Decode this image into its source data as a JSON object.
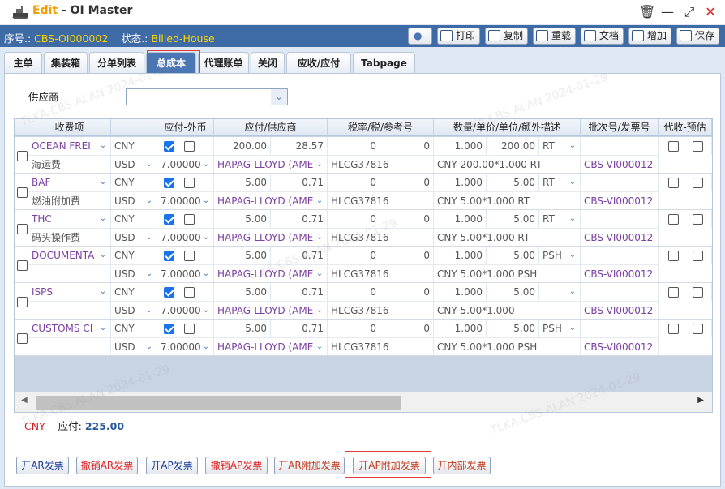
{
  "window": {
    "mode": "Edit",
    "title": "OI Master"
  },
  "info": {
    "seq_label": "序号.:",
    "seq_value": "CBS-OI000002",
    "status_label": "状态.:",
    "status_value": "Billed-House"
  },
  "toolbar": {
    "print": "打印",
    "copy": "复制",
    "reload": "重载",
    "docs": "文档",
    "add": "增加",
    "save": "保存"
  },
  "tabs": [
    "主单",
    "集装箱",
    "分单列表",
    "总成本",
    "代理账单",
    "关闭",
    "应收/应付",
    "Tabpage"
  ],
  "supplier": {
    "label": "供应商",
    "value": ""
  },
  "grid": {
    "headers": [
      "收费项",
      "应付-外币",
      "应付/供应商",
      "税率/税/参考号",
      "数量/单价/单位/额外描述",
      "批次号/发票号",
      "代收-预估"
    ],
    "rows": [
      {
        "code": "OCEAN FREI",
        "name": "海运费",
        "currency": "CNY",
        "fx_ccy": "USD",
        "rate": "7.00000",
        "fc_checked": true,
        "amt": "200.00",
        "amt2": "28.57",
        "supplier": "HAPAG-LLOYD (AME",
        "tax": "0",
        "tax2": "0",
        "ref": "HLCG37816",
        "qty": "1.000",
        "price": "200.00",
        "unit": "RT",
        "desc": "CNY 200.00*1.000 RT",
        "batch": "",
        "invoice": "CBS-VI000012"
      },
      {
        "code": "BAF",
        "name": "燃油附加费",
        "currency": "CNY",
        "fx_ccy": "USD",
        "rate": "7.00000",
        "fc_checked": true,
        "amt": "5.00",
        "amt2": "0.71",
        "supplier": "HAPAG-LLOYD (AME",
        "tax": "0",
        "tax2": "0",
        "ref": "HLCG37816",
        "qty": "1.000",
        "price": "5.00",
        "unit": "RT",
        "desc": "CNY 5.00*1.000 RT",
        "batch": "",
        "invoice": "CBS-VI000012"
      },
      {
        "code": "THC",
        "name": "码头操作费",
        "currency": "CNY",
        "fx_ccy": "USD",
        "rate": "7.00000",
        "fc_checked": true,
        "amt": "5.00",
        "amt2": "0.71",
        "supplier": "HAPAG-LLOYD (AME",
        "tax": "0",
        "tax2": "0",
        "ref": "HLCG37816",
        "qty": "1.000",
        "price": "5.00",
        "unit": "RT",
        "desc": "CNY 5.00*1.000 RT",
        "batch": "",
        "invoice": "CBS-VI000012"
      },
      {
        "code": "DOCUMENTA",
        "name": "",
        "currency": "CNY",
        "fx_ccy": "USD",
        "rate": "7.00000",
        "fc_checked": true,
        "amt": "5.00",
        "amt2": "0.71",
        "supplier": "HAPAG-LLOYD (AME",
        "tax": "0",
        "tax2": "0",
        "ref": "HLCG37816",
        "qty": "1.000",
        "price": "5.00",
        "unit": "PSH",
        "desc": "CNY 5.00*1.000 PSH",
        "batch": "",
        "invoice": "CBS-VI000012"
      },
      {
        "code": "ISPS",
        "name": "",
        "currency": "CNY",
        "fx_ccy": "USD",
        "rate": "7.00000",
        "fc_checked": true,
        "amt": "5.00",
        "amt2": "0.71",
        "supplier": "HAPAG-LLOYD (AME",
        "tax": "0",
        "tax2": "0",
        "ref": "HLCG37816",
        "qty": "1.000",
        "price": "5.00",
        "unit": "",
        "desc": "CNY 5.00*1.000",
        "batch": "",
        "invoice": "CBS-VI000012"
      },
      {
        "code": "CUSTOMS CI",
        "name": "",
        "currency": "CNY",
        "fx_ccy": "USD",
        "rate": "7.00000",
        "fc_checked": true,
        "amt": "5.00",
        "amt2": "0.71",
        "supplier": "HAPAG-LLOYD (AME",
        "tax": "0",
        "tax2": "0",
        "ref": "HLCG37816",
        "qty": "1.000",
        "price": "5.00",
        "unit": "PSH",
        "desc": "CNY 5.00*1.000 PSH",
        "batch": "",
        "invoice": "CBS-VI000012"
      }
    ]
  },
  "footer": {
    "currency": "CNY",
    "label": "应付:",
    "total": "225.00"
  },
  "buttons": [
    "开AR发票",
    "撤销AR发票",
    "开AP发票",
    "撤销AP发票",
    "开AR附加发票",
    "开AP附加发票",
    "开内部发票"
  ],
  "watermark": "TLKA.CBS.ALAN 2024-01-29",
  "colors": {
    "header_blue": "#3e6aa5",
    "accent_yellow": "#ffd700",
    "code_purple": "#7a3fa0",
    "highlight_red": "#e23d3d"
  }
}
